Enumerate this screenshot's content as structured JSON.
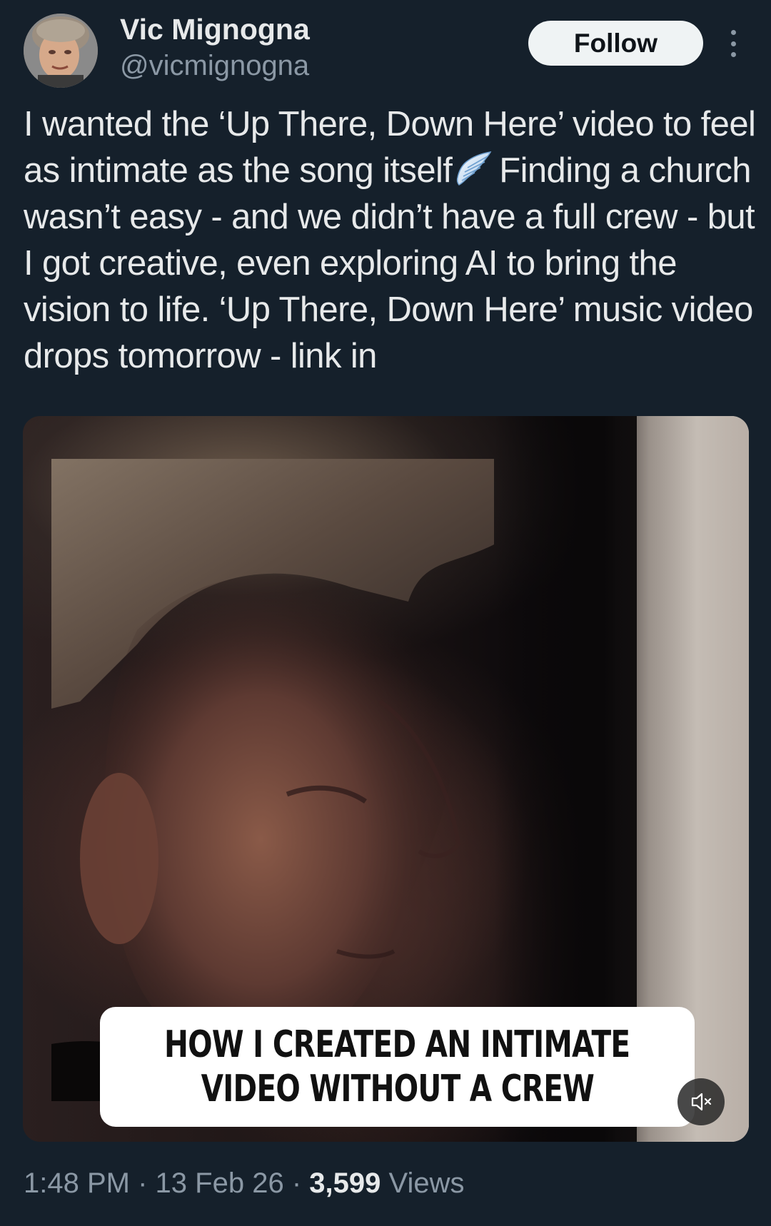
{
  "author": {
    "display_name": "Vic Mignogna",
    "handle": "@vicmignogna"
  },
  "actions": {
    "follow_label": "Follow",
    "more_icon": "more-vertical-icon"
  },
  "tweet": {
    "text_part1": "I wanted the ‘Up There, Down Here’ video to feel as intimate as the song itself",
    "emoji_icon": "wing-icon",
    "text_part2": "Finding a church wasn’t easy - and we didn’t have a full crew - but I got creative, even exploring AI to bring the vision to life. ‘Up There, Down Here’ music video drops tomorrow - link in"
  },
  "media": {
    "caption_line1": "HOW I CREATED AN INTIMATE",
    "caption_line2": "VIDEO WITHOUT A CREW",
    "mute_icon": "volume-muted-icon"
  },
  "meta": {
    "time": "1:48 PM",
    "separator": "·",
    "date": "13 Feb 26",
    "views_count": "3,599",
    "views_label": "Views"
  },
  "colors": {
    "background": "#15202b",
    "primary_text": "#e7e9ea",
    "secondary_text": "#8b98a5",
    "follow_button_bg": "#eff3f4"
  }
}
